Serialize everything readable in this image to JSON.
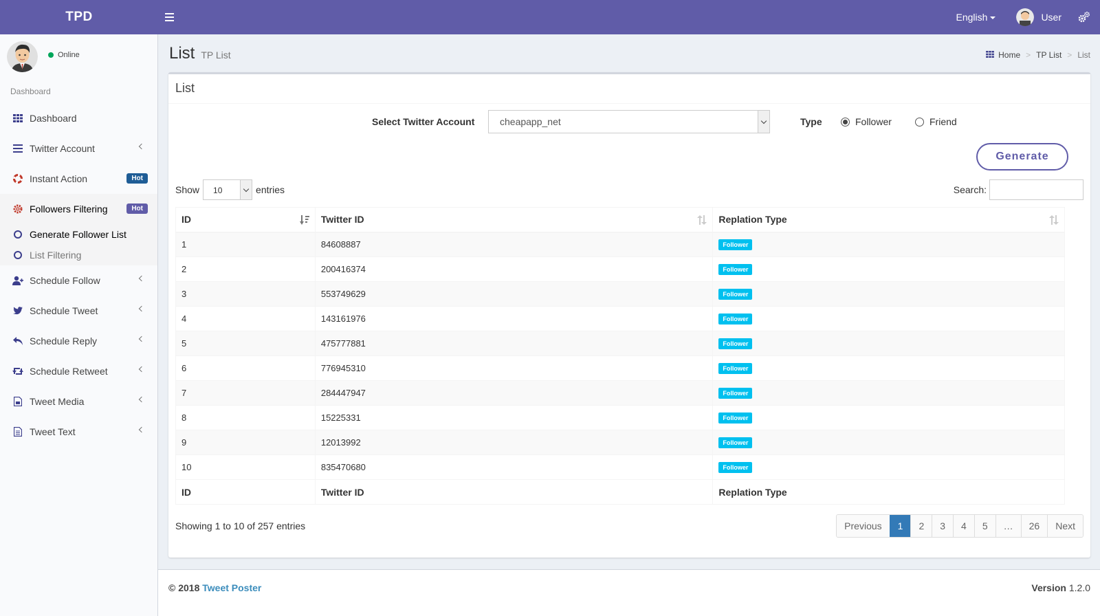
{
  "header": {
    "logo": "TPD",
    "language": "English",
    "user": "User"
  },
  "sidebar": {
    "status": "Online",
    "section_label": "Dashboard",
    "items": [
      {
        "label": "Dashboard",
        "icon": "grid-icon"
      },
      {
        "label": "Twitter Account",
        "icon": "bars-icon"
      },
      {
        "label": "Instant Action",
        "icon": "lifebuoy-icon",
        "badge": "Hot"
      },
      {
        "label": "Followers Filtering",
        "icon": "gear-icon",
        "badge": "Hot"
      },
      {
        "label": "Schedule Follow",
        "icon": "user-plus-icon"
      },
      {
        "label": "Schedule Tweet",
        "icon": "twitter-icon"
      },
      {
        "label": "Schedule Reply",
        "icon": "reply-icon"
      },
      {
        "label": "Schedule Retweet",
        "icon": "retweet-icon"
      },
      {
        "label": "Tweet Media",
        "icon": "media-file-icon"
      },
      {
        "label": "Tweet Text",
        "icon": "text-file-icon"
      }
    ],
    "submenu": [
      {
        "label": "Generate Follower List"
      },
      {
        "label": "List Filtering"
      }
    ]
  },
  "page": {
    "title": "List",
    "subtitle": "TP List",
    "breadcrumb": [
      "Home",
      "TP List",
      "List"
    ]
  },
  "box": {
    "title": "List",
    "account_label": "Select Twitter Account",
    "account_value": "cheapapp_net",
    "type_label": "Type",
    "type_options": [
      "Follower",
      "Friend"
    ],
    "type_selected": "Follower",
    "generate_label": "Generate",
    "show_label": "Show",
    "entries_label": "entries",
    "page_length": "10",
    "search_label": "Search:"
  },
  "table": {
    "columns": [
      "ID",
      "Twitter ID",
      "Replation Type"
    ],
    "rows": [
      {
        "id": "1",
        "twitter_id": "84608887",
        "type": "Follower"
      },
      {
        "id": "2",
        "twitter_id": "200416374",
        "type": "Follower"
      },
      {
        "id": "3",
        "twitter_id": "553749629",
        "type": "Follower"
      },
      {
        "id": "4",
        "twitter_id": "143161976",
        "type": "Follower"
      },
      {
        "id": "5",
        "twitter_id": "475777881",
        "type": "Follower"
      },
      {
        "id": "6",
        "twitter_id": "776945310",
        "type": "Follower"
      },
      {
        "id": "7",
        "twitter_id": "284447947",
        "type": "Follower"
      },
      {
        "id": "8",
        "twitter_id": "15225331",
        "type": "Follower"
      },
      {
        "id": "9",
        "twitter_id": "12013992",
        "type": "Follower"
      },
      {
        "id": "10",
        "twitter_id": "835470680",
        "type": "Follower"
      }
    ],
    "info": "Showing 1 to 10 of 257 entries"
  },
  "pagination": {
    "previous": "Previous",
    "pages": [
      "1",
      "2",
      "3",
      "4",
      "5",
      "…",
      "26"
    ],
    "current": "1",
    "next": "Next"
  },
  "footer": {
    "copyright": "© 2018",
    "brand": "Tweet Poster",
    "version_label": "Version",
    "version": "1.2.0"
  },
  "colors": {
    "header": "#605ca8",
    "accent": "#337ab7",
    "label": "#00c0ef",
    "online": "#00a65a"
  }
}
